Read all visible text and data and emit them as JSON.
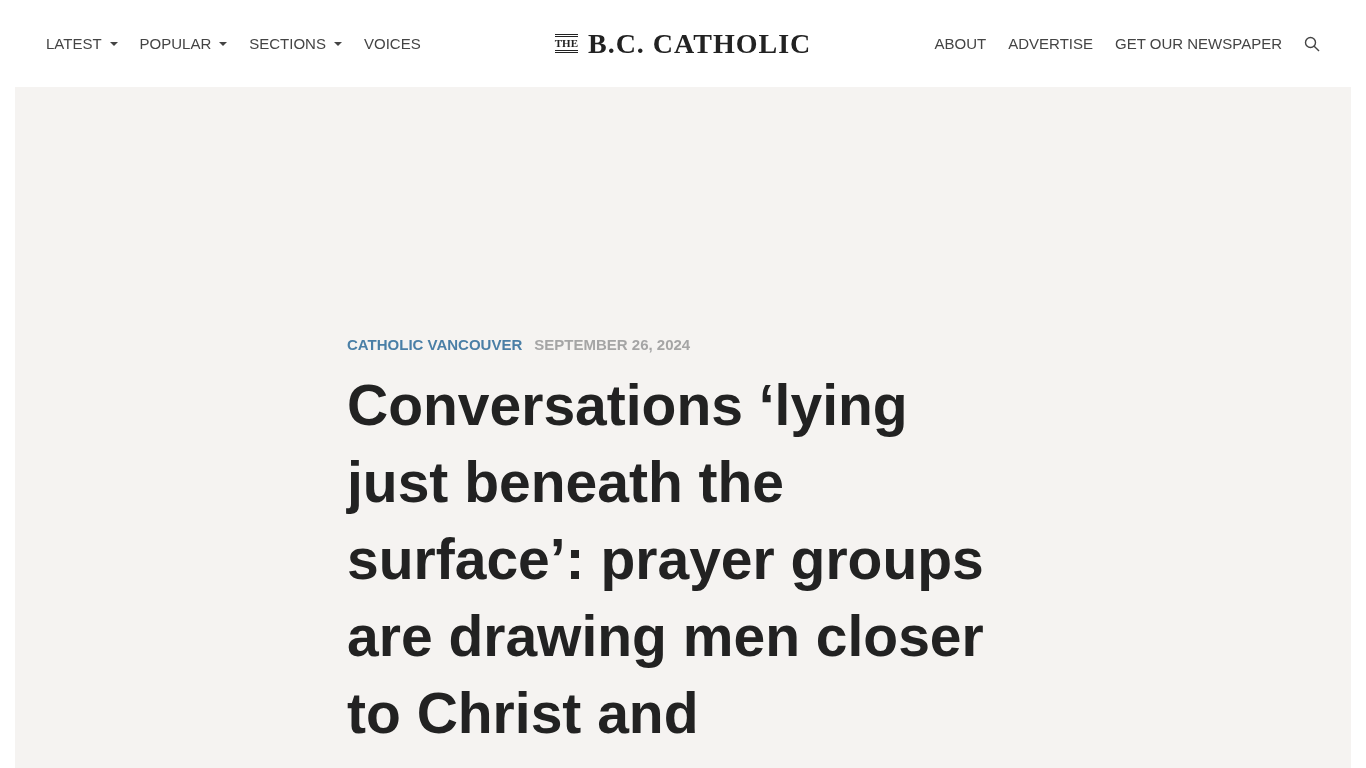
{
  "nav_left": [
    {
      "label": "LATEST",
      "dropdown": true
    },
    {
      "label": "POPULAR",
      "dropdown": true
    },
    {
      "label": "SECTIONS",
      "dropdown": true
    },
    {
      "label": "VOICES",
      "dropdown": false
    }
  ],
  "logo": {
    "small": "THE",
    "main": "B.C. CATHOLIC"
  },
  "nav_right": [
    {
      "label": "ABOUT"
    },
    {
      "label": "ADVERTISE"
    },
    {
      "label": "GET OUR NEWSPAPER"
    }
  ],
  "article": {
    "category": "CATHOLIC VANCOUVER",
    "date": "SEPTEMBER 26, 2024",
    "headline": "Conversations ‘lying just beneath the surface’: prayer groups are drawing men closer to Christ and"
  }
}
